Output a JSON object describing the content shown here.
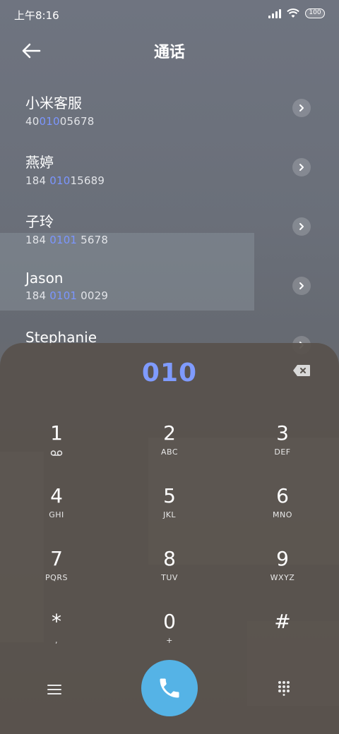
{
  "status": {
    "time": "上午8:16",
    "battery": "100"
  },
  "header": {
    "title": "通话"
  },
  "contacts": [
    {
      "name": "小米客服",
      "number_pre": "40",
      "number_hl": "010",
      "number_post": "05678"
    },
    {
      "name": "燕婷",
      "number_pre": "184 ",
      "number_hl": "010",
      "number_post": "15689"
    },
    {
      "name": "子玲",
      "number_pre": "184 ",
      "number_hl": "0101",
      "number_post": " 5678"
    },
    {
      "name": "Jason",
      "number_pre": "184 ",
      "number_hl": "0101",
      "number_post": " 0029"
    },
    {
      "name": "Stephanie",
      "number_pre": "",
      "number_hl": "",
      "number_post": ""
    }
  ],
  "dialer": {
    "input": "010",
    "keys": [
      {
        "digit": "1",
        "letters": ""
      },
      {
        "digit": "2",
        "letters": "ABC"
      },
      {
        "digit": "3",
        "letters": "DEF"
      },
      {
        "digit": "4",
        "letters": "GHI"
      },
      {
        "digit": "5",
        "letters": "JKL"
      },
      {
        "digit": "6",
        "letters": "MNO"
      },
      {
        "digit": "7",
        "letters": "PQRS"
      },
      {
        "digit": "8",
        "letters": "TUV"
      },
      {
        "digit": "9",
        "letters": "WXYZ"
      },
      {
        "digit": "*",
        "letters": ","
      },
      {
        "digit": "0",
        "letters": "+"
      },
      {
        "digit": "#",
        "letters": ""
      }
    ]
  },
  "colors": {
    "highlight": "#7b96ff",
    "call_button": "#55b3e6"
  },
  "icons": {
    "back": "arrow-left-icon",
    "chevron": "chevron-right-icon",
    "backspace": "backspace-icon",
    "voicemail": "voicemail-icon",
    "menu": "menu-icon",
    "call": "phone-icon",
    "keypad": "keypad-icon"
  }
}
